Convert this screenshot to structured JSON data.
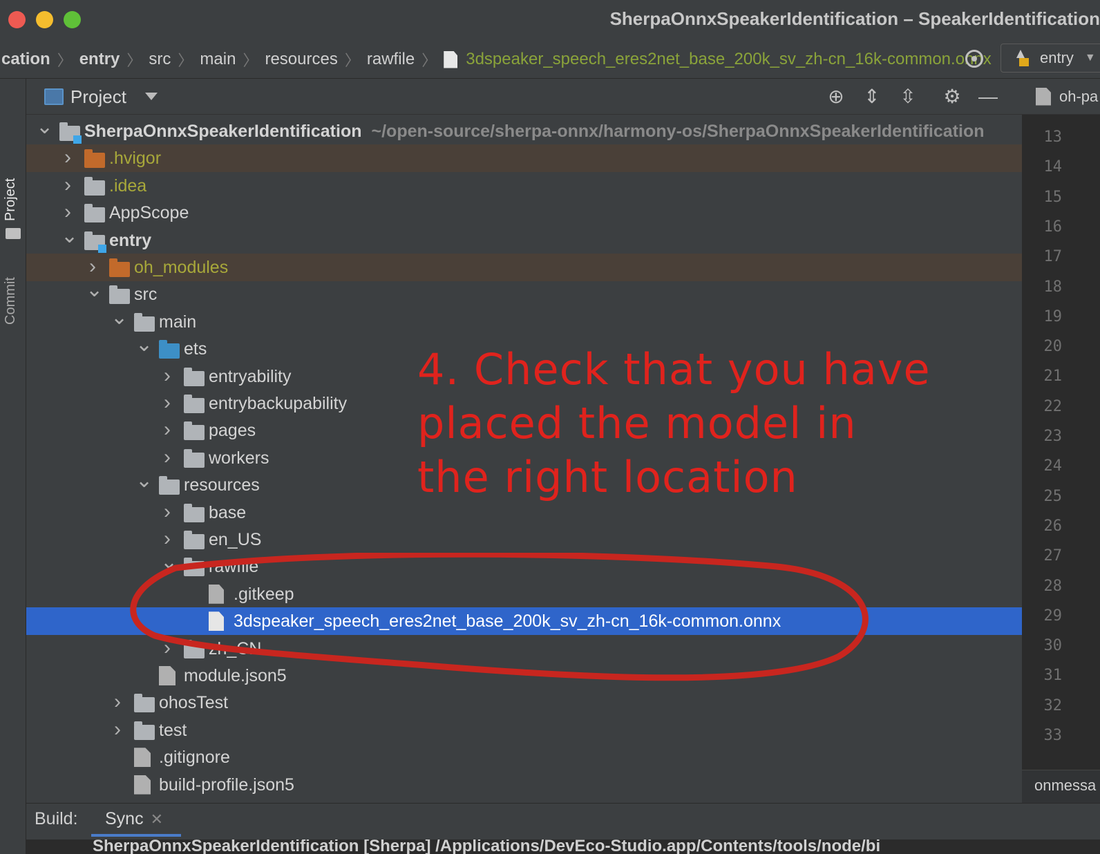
{
  "window": {
    "title": "SherpaOnnxSpeakerIdentification – SpeakerIdentification",
    "controls": [
      "close",
      "minimize",
      "zoom"
    ]
  },
  "breadcrumb": {
    "items": [
      "cation",
      "entry",
      "src",
      "main",
      "resources",
      "rawfile"
    ],
    "file": "3dspeaker_speech_eres2net_base_200k_sv_zh-cn_16k-common.onnx"
  },
  "run_config": {
    "label": "entry"
  },
  "tool_strip": {
    "project_tab": "Project",
    "commit_tab": "Commit"
  },
  "project_panel": {
    "title": "Project",
    "tree": [
      {
        "label": "SherpaOnnxSpeakerIdentification",
        "hint": "~/open-source/sherpa-onnx/harmony-os/SherpaOnnxSpeakerIdentification",
        "depth": 0,
        "expanded": true,
        "icon": "module-folder-icon",
        "bold": true
      },
      {
        "label": ".hvigor",
        "depth": 1,
        "expanded": false,
        "icon": "excluded-folder-icon",
        "excluded": true
      },
      {
        "label": ".idea",
        "depth": 1,
        "expanded": false,
        "icon": "folder-icon",
        "yellow": true
      },
      {
        "label": "AppScope",
        "depth": 1,
        "expanded": false,
        "icon": "folder-icon"
      },
      {
        "label": "entry",
        "depth": 1,
        "expanded": true,
        "icon": "module-folder-icon",
        "bold": true
      },
      {
        "label": "oh_modules",
        "depth": 2,
        "expanded": false,
        "icon": "excluded-folder-icon",
        "excluded": true
      },
      {
        "label": "src",
        "depth": 2,
        "expanded": true,
        "icon": "folder-icon"
      },
      {
        "label": "main",
        "depth": 3,
        "expanded": true,
        "icon": "folder-icon"
      },
      {
        "label": "ets",
        "depth": 4,
        "expanded": true,
        "icon": "source-folder-icon"
      },
      {
        "label": "entryability",
        "depth": 5,
        "expanded": false,
        "icon": "folder-icon"
      },
      {
        "label": "entrybackupability",
        "depth": 5,
        "expanded": false,
        "icon": "folder-icon"
      },
      {
        "label": "pages",
        "depth": 5,
        "expanded": false,
        "icon": "folder-icon"
      },
      {
        "label": "workers",
        "depth": 5,
        "expanded": false,
        "icon": "folder-icon"
      },
      {
        "label": "resources",
        "depth": 4,
        "expanded": true,
        "icon": "folder-icon"
      },
      {
        "label": "base",
        "depth": 5,
        "expanded": false,
        "icon": "folder-icon"
      },
      {
        "label": "en_US",
        "depth": 5,
        "expanded": false,
        "icon": "folder-icon"
      },
      {
        "label": "rawfile",
        "depth": 5,
        "expanded": true,
        "icon": "folder-icon"
      },
      {
        "label": ".gitkeep",
        "depth": 6,
        "icon": "text-file-icon"
      },
      {
        "label": "3dspeaker_speech_eres2net_base_200k_sv_zh-cn_16k-common.onnx",
        "depth": 6,
        "icon": "file-icon",
        "selected": true
      },
      {
        "label": "zh_CN",
        "depth": 5,
        "expanded": false,
        "icon": "folder-icon"
      },
      {
        "label": "module.json5",
        "depth": 4,
        "icon": "json-file-icon"
      },
      {
        "label": "ohosTest",
        "depth": 3,
        "expanded": false,
        "icon": "folder-icon"
      },
      {
        "label": "test",
        "depth": 3,
        "expanded": false,
        "icon": "folder-icon"
      },
      {
        "label": ".gitignore",
        "depth": 3,
        "icon": "gitignore-file-icon"
      },
      {
        "label": "build-profile.json5",
        "depth": 3,
        "icon": "json-file-icon"
      }
    ]
  },
  "editor": {
    "tab_label": "oh-pa",
    "line_numbers": [
      "13",
      "14",
      "15",
      "16",
      "17",
      "18",
      "19",
      "20",
      "21",
      "22",
      "23",
      "24",
      "25",
      "26",
      "27",
      "28",
      "29",
      "30",
      "31",
      "32",
      "33"
    ],
    "footer": "onmessa"
  },
  "build": {
    "label": "Build:",
    "tab": "Sync",
    "output": "SherpaOnnxSpeakerIdentification [Sherpa] /Applications/DevEco-Studio.app/Contents/tools/node/bi"
  },
  "annotation": {
    "text": "4. Check that you have placed the model in the right location",
    "color": "#e0231d"
  }
}
